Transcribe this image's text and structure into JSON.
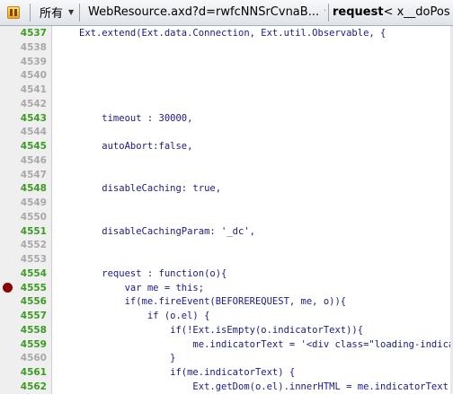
{
  "toolbar": {
    "scope_label": "所有",
    "script_label": "WebResource.axd?d=rwfcNNSrCvnaB...",
    "crumb_current": "request",
    "crumb_rest": " < x__doPos"
  },
  "breakpoint_color": "#8b0000",
  "lines": [
    {
      "num": "4537",
      "exec": true,
      "code": "Ext.extend(Ext.data.Connection, Ext.util.Observable, {"
    },
    {
      "num": "4538",
      "exec": false,
      "code": ""
    },
    {
      "num": "4539",
      "exec": false,
      "code": ""
    },
    {
      "num": "4540",
      "exec": false,
      "code": ""
    },
    {
      "num": "4541",
      "exec": false,
      "code": ""
    },
    {
      "num": "4542",
      "exec": false,
      "code": ""
    },
    {
      "num": "4543",
      "exec": true,
      "code": "    timeout : 30000,"
    },
    {
      "num": "4544",
      "exec": false,
      "code": ""
    },
    {
      "num": "4545",
      "exec": true,
      "code": "    autoAbort:false,"
    },
    {
      "num": "4546",
      "exec": false,
      "code": ""
    },
    {
      "num": "4547",
      "exec": false,
      "code": ""
    },
    {
      "num": "4548",
      "exec": true,
      "code": "    disableCaching: true,"
    },
    {
      "num": "4549",
      "exec": false,
      "code": ""
    },
    {
      "num": "4550",
      "exec": false,
      "code": ""
    },
    {
      "num": "4551",
      "exec": true,
      "code": "    disableCachingParam: '_dc',"
    },
    {
      "num": "4552",
      "exec": false,
      "code": ""
    },
    {
      "num": "4553",
      "exec": false,
      "code": ""
    },
    {
      "num": "4554",
      "exec": true,
      "code": "    request : function(o){"
    },
    {
      "num": "4555",
      "exec": true,
      "breakpoint": true,
      "code": "        var me = this;"
    },
    {
      "num": "4556",
      "exec": true,
      "code": "        if(me.fireEvent(BEFOREREQUEST, me, o)){"
    },
    {
      "num": "4557",
      "exec": true,
      "code": "            if (o.el) {"
    },
    {
      "num": "4558",
      "exec": true,
      "code": "                if(!Ext.isEmpty(o.indicatorText)){"
    },
    {
      "num": "4559",
      "exec": true,
      "code": "                    me.indicatorText = '<div class=\"loading-indicato"
    },
    {
      "num": "4560",
      "exec": false,
      "code": "                }"
    },
    {
      "num": "4561",
      "exec": true,
      "code": "                if(me.indicatorText) {"
    },
    {
      "num": "4562",
      "exec": true,
      "code": "                    Ext.getDom(o.el).innerHTML = me.indicatorText;"
    }
  ]
}
